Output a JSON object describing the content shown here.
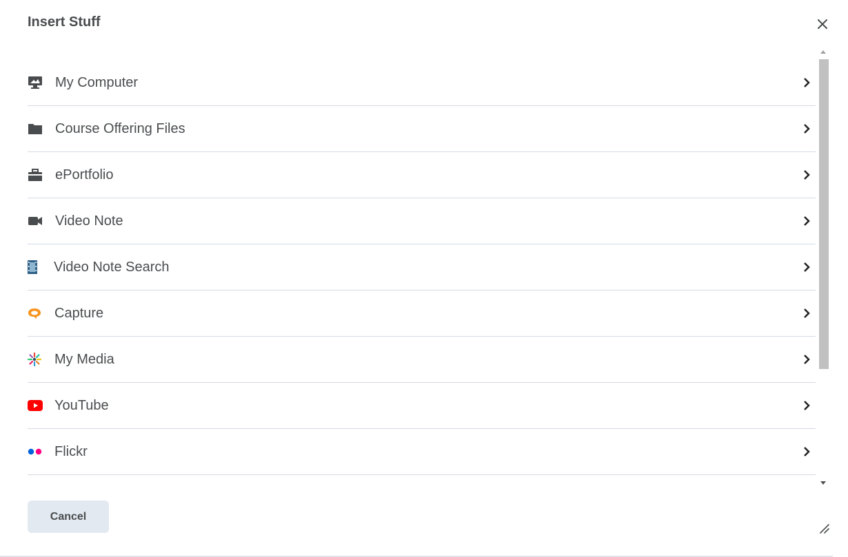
{
  "dialog": {
    "title": "Insert Stuff",
    "close_icon": "close-icon",
    "cancel_label": "Cancel"
  },
  "items": [
    {
      "label": "My Computer",
      "icon": "computer-icon",
      "chevron": "chevron-right-icon"
    },
    {
      "label": "Course Offering Files",
      "icon": "folder-icon",
      "chevron": "chevron-right-icon"
    },
    {
      "label": "ePortfolio",
      "icon": "briefcase-icon",
      "chevron": "chevron-right-icon"
    },
    {
      "label": "Video Note",
      "icon": "video-camera-icon",
      "chevron": "chevron-right-icon"
    },
    {
      "label": "Video Note Search",
      "icon": "film-icon",
      "chevron": "chevron-right-icon"
    },
    {
      "label": "Capture",
      "icon": "capture-icon",
      "chevron": "chevron-right-icon"
    },
    {
      "label": "My Media",
      "icon": "my-media-icon",
      "chevron": "chevron-right-icon"
    },
    {
      "label": "YouTube",
      "icon": "youtube-icon",
      "chevron": "chevron-right-icon"
    },
    {
      "label": "Flickr",
      "icon": "flickr-icon",
      "chevron": "chevron-right-icon"
    }
  ],
  "colors": {
    "text": "#494c4e",
    "divider": "#d3d9e3",
    "cancel_bg": "#e3e9f1",
    "capture": "#f7941d",
    "youtube": "#ff0000",
    "flickr_blue": "#0063dc",
    "flickr_pink": "#ff0084"
  }
}
